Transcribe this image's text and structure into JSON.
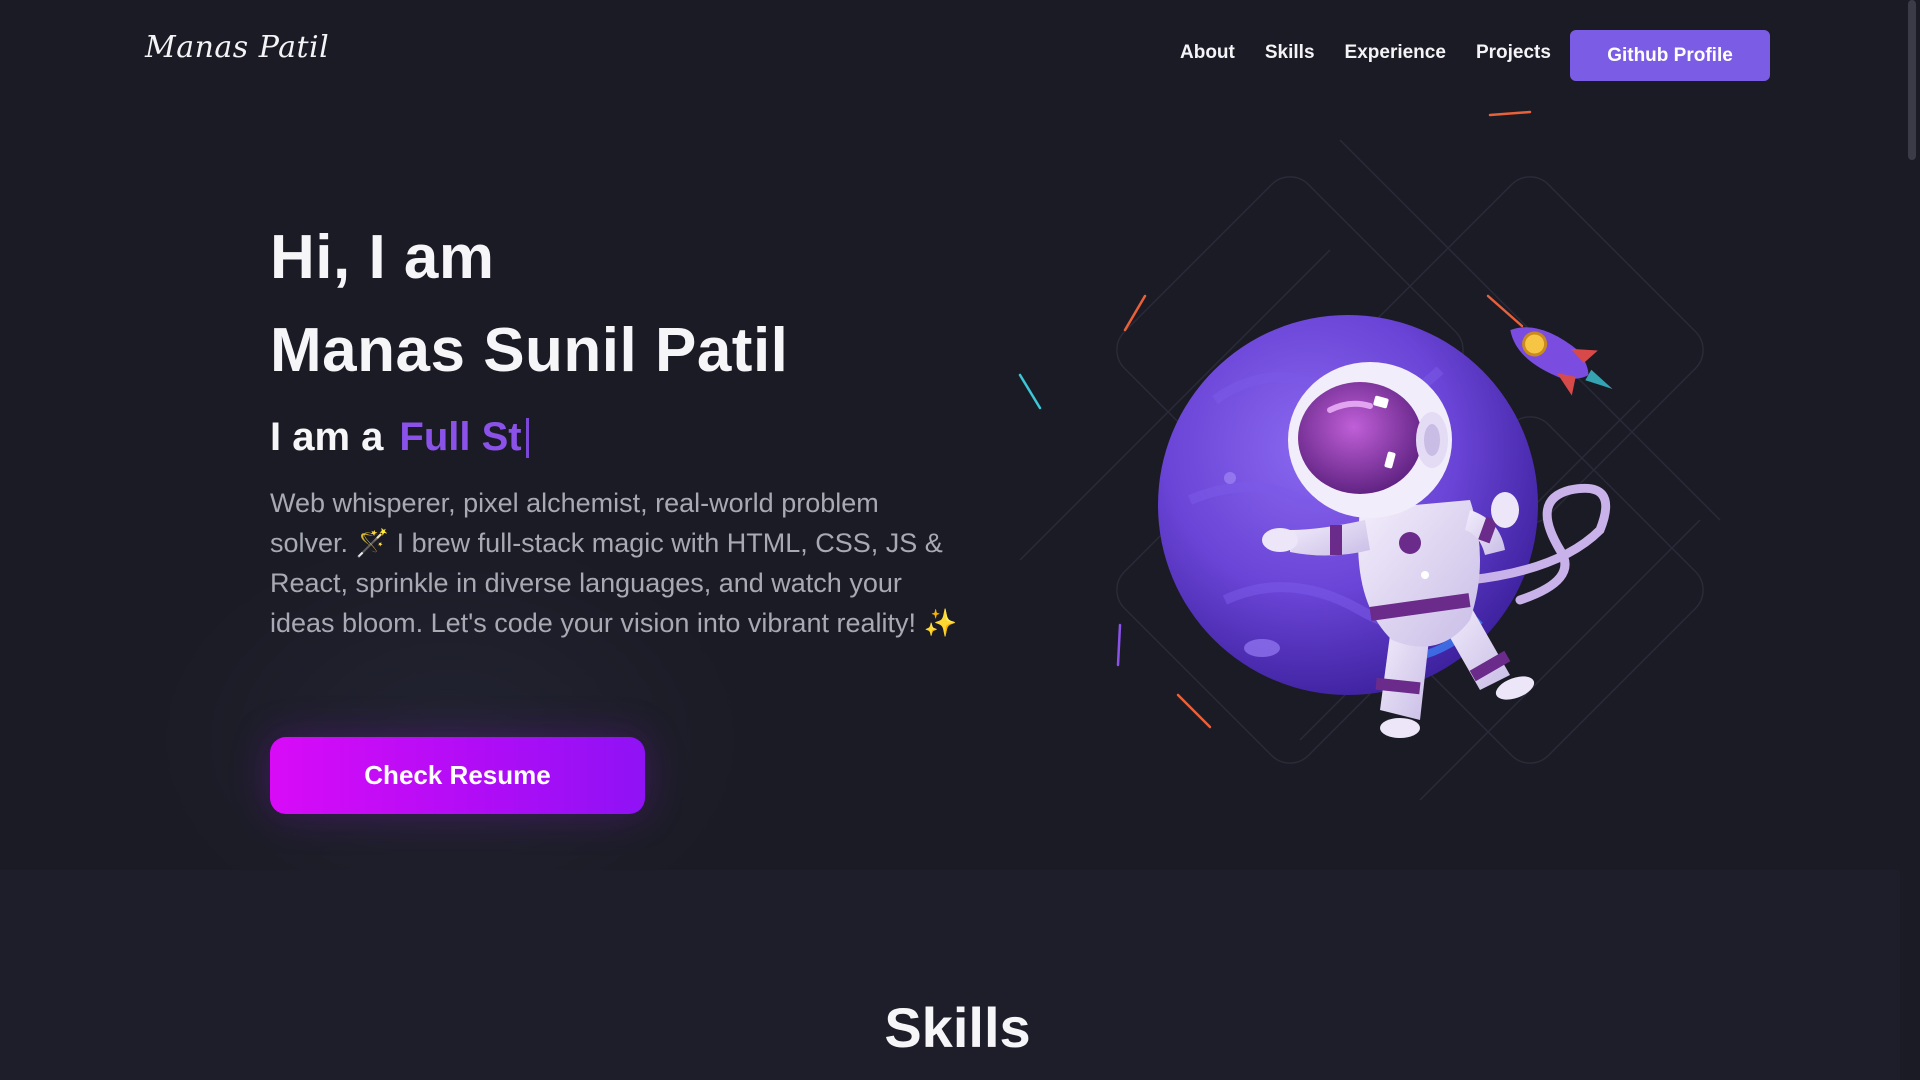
{
  "header": {
    "logo": "Manas Patil",
    "nav": [
      {
        "label": "About"
      },
      {
        "label": "Skills"
      },
      {
        "label": "Experience"
      },
      {
        "label": "Projects"
      }
    ],
    "github_button": "Github Profile"
  },
  "hero": {
    "greeting": "Hi, I am",
    "name": "Manas Sunil Patil",
    "role_prefix": "I am a",
    "role_typed": "Full St",
    "description": "Web whisperer, pixel alchemist, real-world problem solver. 🪄 I brew full-stack magic with HTML, CSS, JS & React, sprinkle in diverse languages, and watch your ideas bloom. Let's code your vision into vibrant reality! ✨",
    "resume_button": "Check Resume"
  },
  "skills_section": {
    "title": "Skills"
  },
  "colors": {
    "background": "#1b1b25",
    "accent": "#7b5ce5",
    "typed_text": "#8a52e8",
    "button_gradient_start": "#d90bf7",
    "button_gradient_end": "#8f12f5",
    "body_text": "#a8a9b2"
  },
  "icons": {
    "illustration": "astronaut-planet-illustration",
    "rocket": "rocket-icon"
  }
}
